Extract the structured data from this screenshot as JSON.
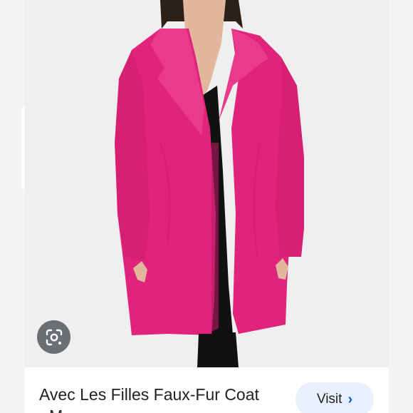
{
  "product": {
    "title": "Avec Les Filles Faux-Fur Coat",
    "title_line2": "- M..."
  },
  "actions": {
    "visit_label": "Visit",
    "visit_icon": "chevron-right-icon",
    "lens_icon": "google-lens-icon"
  },
  "colors": {
    "coat": "#e5247d",
    "visit_bg": "#e8f0fe",
    "lens_bg": "#5f6368"
  }
}
